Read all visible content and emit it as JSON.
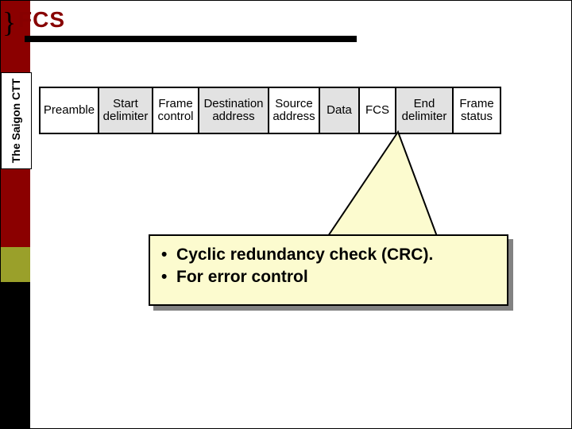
{
  "header": {
    "brace": "}",
    "title": "FCS"
  },
  "sidebar": {
    "label": "The Saigon CTT"
  },
  "frame": {
    "fields": [
      {
        "label": "Preamble",
        "key": "preamble"
      },
      {
        "label": "Start delimiter",
        "key": "start"
      },
      {
        "label": "Frame control",
        "key": "framec"
      },
      {
        "label": "Destination address",
        "key": "dest"
      },
      {
        "label": "Source address",
        "key": "src"
      },
      {
        "label": "Data",
        "key": "data"
      },
      {
        "label": "FCS",
        "key": "fcs"
      },
      {
        "label": "End delimiter",
        "key": "end"
      },
      {
        "label": "Frame status",
        "key": "status"
      }
    ]
  },
  "callout": {
    "lines": [
      "Cyclic redundancy check (CRC).",
      "For error control"
    ]
  }
}
